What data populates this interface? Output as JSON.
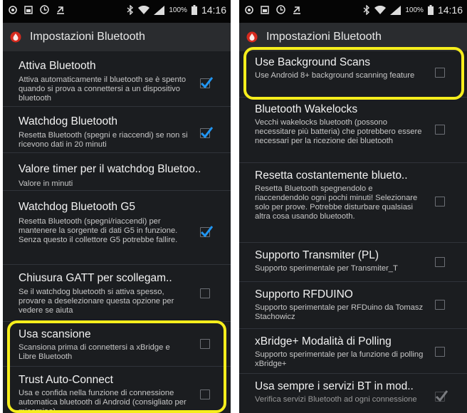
{
  "status_bar": {
    "battery_percent": "100%",
    "time": "14:16",
    "left_icons": [
      "app-circle-icon",
      "gallery-icon",
      "clock-icon",
      "download-icon"
    ],
    "right_icons": [
      "bluetooth-icon",
      "wifi-icon",
      "signal-icon",
      "battery-icon"
    ]
  },
  "colors": {
    "accent_check": "#2196f3",
    "highlight": "#f6ee1c",
    "background": "#1b1d20"
  },
  "left_screen": {
    "title": "Impostazioni Bluetooth",
    "items": [
      {
        "title": "Attiva Bluetooth",
        "summary": "Attiva automaticamente il bluetooth se è spento quando si prova a connettersi a un dispositivo bluetooth",
        "checked": true
      },
      {
        "title": "Watchdog Bluetooth",
        "summary": "Resetta Bluetooth (spegni e riaccendi) se non si ricevono dati in 20 minuti",
        "checked": true
      },
      {
        "title": "Valore timer per il watchdog Bluetoo..",
        "summary": "Valore in minuti"
      },
      {
        "title": "Watchdog Bluetooth G5",
        "summary": "Resetta Bluetooth (spegni/riaccendi) per mantenere la sorgente di dati G5 in funzione. Senza questo il collettore G5 potrebbe fallire.",
        "checked": true
      },
      {
        "title": "Chiusura GATT per scollegam..",
        "summary": "Se il watchdog bluetooth si attiva spesso, provare a deselezionare questa opzione per vedere se aiuta",
        "checked": false
      },
      {
        "title": "Usa scansione",
        "summary": "Scansiona prima di connettersi a xBridge e Libre Bluetooth",
        "checked": false
      },
      {
        "title": "Trust Auto-Connect",
        "summary": "Usa e confida nella funzione di connessione automatica bluetooth di Android (consigliato per miaomiao)",
        "checked": false
      }
    ]
  },
  "right_screen": {
    "title": "Impostazioni Bluetooth",
    "items": [
      {
        "title": "Use Background Scans",
        "summary": "Use Android 8+ background scanning feature",
        "checked": false
      },
      {
        "title": "Bluetooth Wakelocks",
        "summary": "Vecchi wakelocks bluetooth (possono necessitare più batteria) che potrebbero essere necessari per la ricezione dei bluetooth",
        "checked": false
      },
      {
        "title": "Resetta costantemente blueto..",
        "summary": "Resetta Bluetooth spegnendolo e riaccendendolo ogni pochi minuti! Selezionare solo per prove. Potrebbe disturbare qualsiasi altra cosa usando bluetooth.",
        "checked": false
      },
      {
        "title": "Supporto Transmiter (PL)",
        "summary": "Supporto sperimentale per Transmiter_T",
        "checked": false
      },
      {
        "title": "Supporto RFDUINO",
        "summary": "Supporto sperimentale per RFDuino da Tomasz Stachowicz",
        "checked": false
      },
      {
        "title": "xBridge+ Modalità di Polling",
        "summary": "Supporto sperimentale per la funzione di polling xBridge+",
        "checked": false
      },
      {
        "title": "Usa sempre i servizi BT in mod..",
        "summary": "Verifica servizi Bluetooth ad ogni connessione",
        "checked": true,
        "disabled": true
      }
    ]
  }
}
